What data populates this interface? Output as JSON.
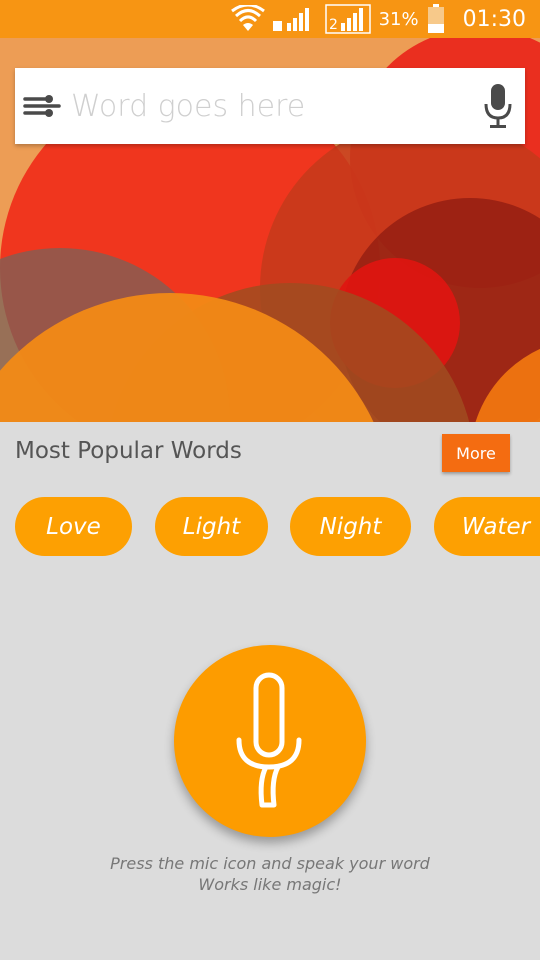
{
  "status_bar": {
    "battery_percent": "31%",
    "time": "01:30",
    "sim2_label": "2"
  },
  "search": {
    "placeholder": "Word goes here"
  },
  "popular": {
    "title": "Most Popular Words",
    "more_label": "More",
    "words": [
      "Love",
      "Light",
      "Night",
      "Water"
    ]
  },
  "voice": {
    "hint_line1": "Press the mic icon and speak your word",
    "hint_line2": "Works like magic!"
  },
  "colors": {
    "accent": "#fd9c00",
    "status_bar": "#f79513",
    "more_button": "#f46c11",
    "background": "#dcdcdc"
  }
}
